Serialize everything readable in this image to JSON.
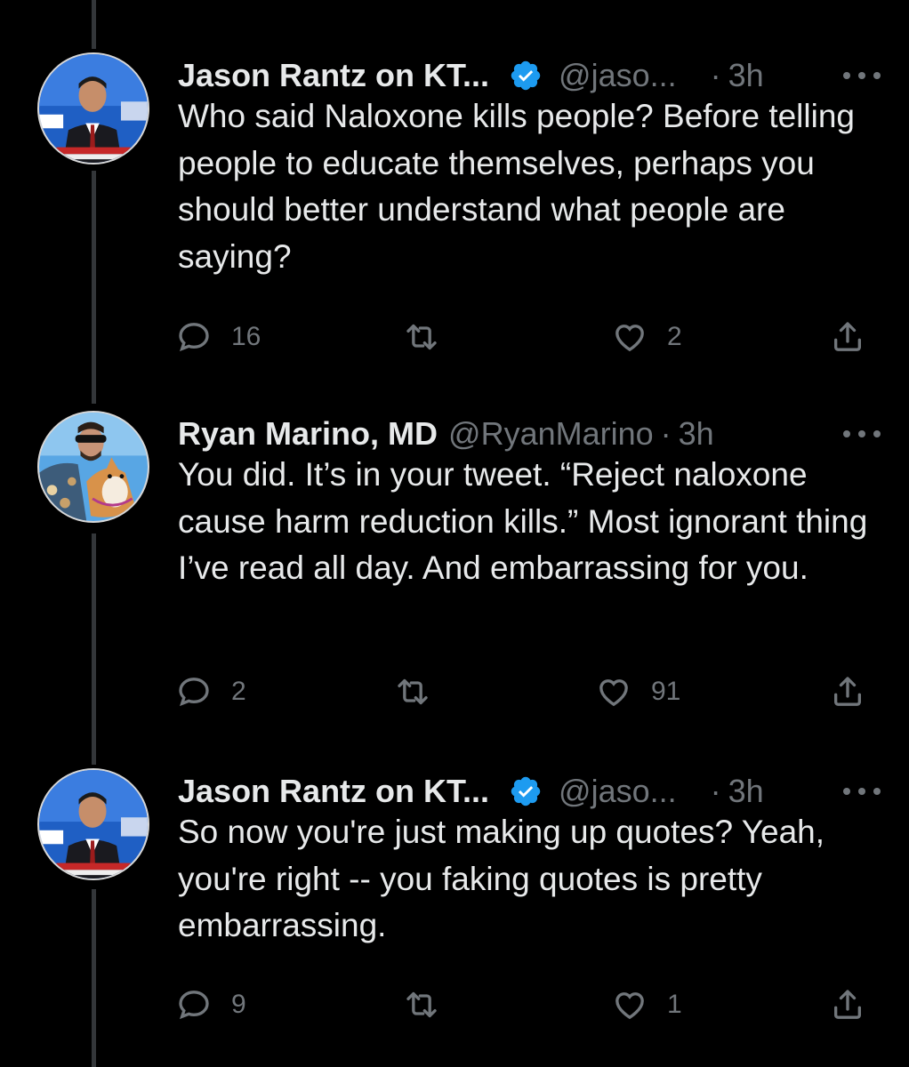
{
  "tweets": [
    {
      "name": "Jason Rantz on KT...",
      "verified": true,
      "handle": "@jaso...",
      "separator": "·",
      "time": "3h",
      "text": "Who said Naloxone kills people? Before telling people to educate themselves, perhaps you should better understand what people are saying?",
      "replies": "16",
      "retweets": "",
      "likes": "2"
    },
    {
      "name": "Ryan Marino, MD",
      "verified": false,
      "handle": "@RyanMarino",
      "separator": "·",
      "time": "3h",
      "text": "You did. It’s in your tweet. “Reject naloxone cause harm reduction kills.” Most ignorant thing I’ve read all day. And embarrassing for you.",
      "replies": "2",
      "retweets": "",
      "likes": "91"
    },
    {
      "name": "Jason Rantz on KT...",
      "verified": true,
      "handle": "@jaso...",
      "separator": "·",
      "time": "3h",
      "text": "So now you're just making up quotes? Yeah, you're right -- you faking quotes is pretty embarrassing.",
      "replies": "9",
      "retweets": "",
      "likes": "1"
    }
  ],
  "icons": {
    "reply": "reply-icon",
    "retweet": "retweet-icon",
    "like": "heart-icon",
    "share": "share-icon",
    "more": "more-icon",
    "verified": "verified-badge-icon"
  },
  "colors": {
    "background": "#000000",
    "text": "#e7e9ea",
    "muted": "#71767b",
    "verified": "#1d9bf0",
    "thread_line": "#333639"
  }
}
